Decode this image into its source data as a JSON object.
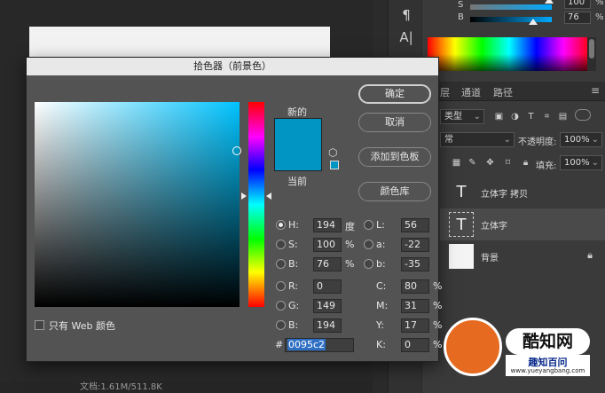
{
  "dialog": {
    "title": "拾色器（前景色）",
    "new_label": "新的",
    "current_label": "当前",
    "new_color": "#0095c2",
    "current_color": "#0095c2",
    "buttons": {
      "ok": "确定",
      "cancel": "取消",
      "add_to_swatches": "添加到色板",
      "color_libraries": "颜色库"
    },
    "fields": {
      "H": {
        "label": "H:",
        "value": "194",
        "unit": "度",
        "selected": true
      },
      "S": {
        "label": "S:",
        "value": "100",
        "unit": "%"
      },
      "B": {
        "label": "B:",
        "value": "76",
        "unit": "%"
      },
      "R": {
        "label": "R:",
        "value": "0"
      },
      "G": {
        "label": "G:",
        "value": "149"
      },
      "Bb": {
        "label": "B:",
        "value": "194"
      },
      "L": {
        "label": "L:",
        "value": "56"
      },
      "a": {
        "label": "a:",
        "value": "-22"
      },
      "b": {
        "label": "b:",
        "value": "-35"
      },
      "C": {
        "label": "C:",
        "value": "80",
        "unit": "%"
      },
      "M": {
        "label": "M:",
        "value": "31",
        "unit": "%"
      },
      "Y": {
        "label": "Y:",
        "value": "17",
        "unit": "%"
      },
      "K": {
        "label": "K:",
        "value": "0",
        "unit": "%"
      }
    },
    "hex_prefix": "#",
    "hex_value": "0095c2",
    "web_only_label": "只有 Web 颜色"
  },
  "top_sliders": {
    "S": {
      "label": "S",
      "value": "100",
      "unit": "%"
    },
    "B": {
      "label": "B",
      "value": "76",
      "unit": "%"
    }
  },
  "layers_panel": {
    "tabs": [
      "层",
      "通道",
      "路径"
    ],
    "kind_label": "类型",
    "blend_mode": "常",
    "opacity_label": "不透明度:",
    "opacity_value": "100%",
    "fill_label": "填充:",
    "fill_value": "100%",
    "layers": [
      {
        "name": "立体字 拷贝",
        "type": "text"
      },
      {
        "name": "立体字",
        "type": "text",
        "selected": true
      },
      {
        "name": "背景",
        "type": "background",
        "locked": true
      }
    ]
  },
  "status_bar": {
    "doc_info": "文档:1.61M/511.8K"
  },
  "watermark": {
    "brand": "酷知网",
    "site": "趣知百问",
    "url": "www.yueyangbang.com"
  },
  "icons": [
    "paragraph-icon",
    "text-cursor-icon",
    "cube-icon",
    "lock-icon",
    "menu-icon"
  ]
}
